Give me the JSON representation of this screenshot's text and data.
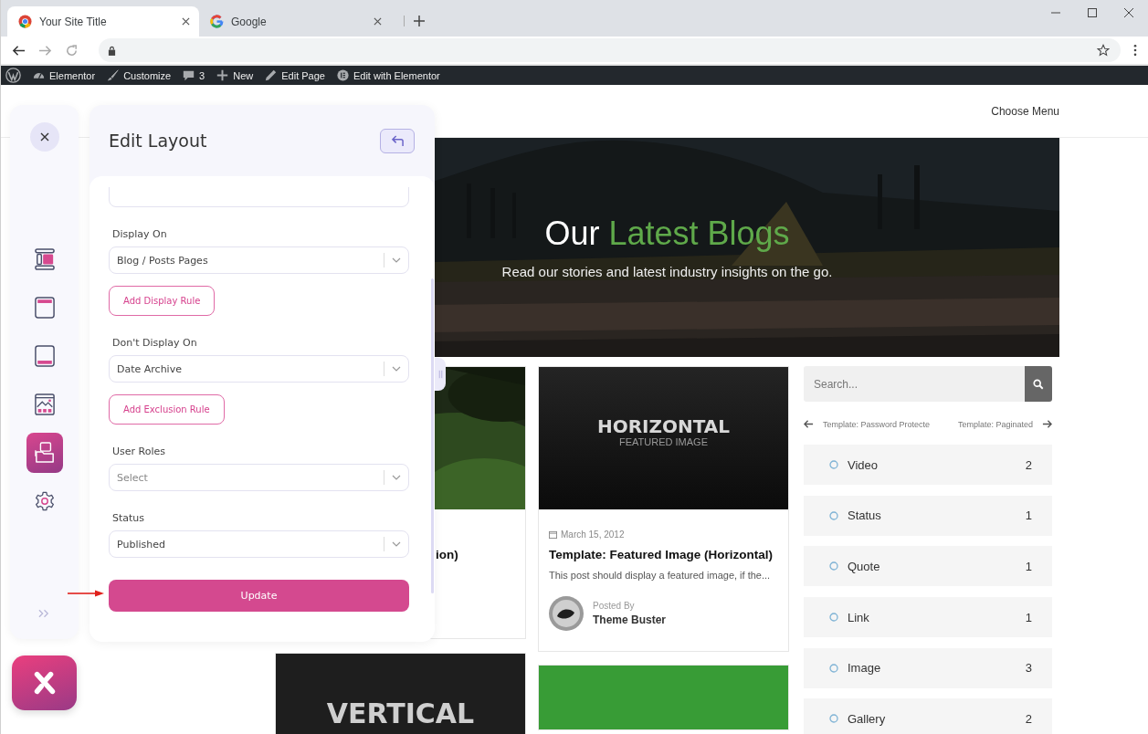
{
  "browser": {
    "tabs": [
      {
        "title": "Your Site Title",
        "selected": true
      },
      {
        "title": "Google",
        "selected": false
      }
    ]
  },
  "admin_bar": {
    "items": [
      {
        "label": "Elementor",
        "kind": "dashboard"
      },
      {
        "label": "Customize",
        "kind": "brush"
      },
      {
        "label": "3",
        "kind": "comment"
      },
      {
        "label": "New",
        "kind": "plus"
      },
      {
        "label": "Edit Page",
        "kind": "pencil"
      },
      {
        "label": "Edit with Elementor",
        "kind": "elementor"
      }
    ]
  },
  "site_header": {
    "menu": "Choose Menu"
  },
  "hero": {
    "title_start": "Our",
    "title_highlight": "Latest Blogs",
    "subtitle": "Read our stories and latest industry insights on the go."
  },
  "left_column_posts": [
    {
      "title": "ion)"
    },
    {
      "image": {
        "kind": "graphic",
        "title": "VERTICAL"
      }
    }
  ],
  "middle_column_posts": [
    {
      "image": {
        "kind": "graphic",
        "title": "HORIZONTAL",
        "subtitle": "FEATURED IMAGE"
      },
      "date": "March 15, 2012",
      "title": "Template: Featured Image (Horizontal)",
      "excerpt": "This post should display a featured image, if the...",
      "author_label": "Posted By",
      "author": "Theme Buster"
    },
    {
      "image": {
        "kind": "flat"
      }
    }
  ],
  "sidebar": {
    "search": {
      "placeholder": "Search..."
    },
    "nav": {
      "previous": "Template: Password Protecte",
      "next": "Template: Paginated"
    },
    "categories": [
      {
        "name": "Video",
        "count": "2"
      },
      {
        "name": "Status",
        "count": "1"
      },
      {
        "name": "Quote",
        "count": "1"
      },
      {
        "name": "Link",
        "count": "1"
      },
      {
        "name": "Image",
        "count": "3"
      },
      {
        "name": "Gallery",
        "count": "2"
      }
    ]
  },
  "rail": {
    "items": [
      {
        "kind": "layout",
        "selected": false
      },
      {
        "kind": "header",
        "selected": false
      },
      {
        "kind": "footer",
        "selected": false
      },
      {
        "kind": "gallery",
        "selected": false
      },
      {
        "kind": "folder",
        "selected": true
      },
      {
        "kind": "settings",
        "selected": false
      }
    ]
  },
  "panel": {
    "title": "Edit Layout",
    "fields": [
      {
        "label": "Display On",
        "value": "Blog / Posts Pages",
        "action": "Add Display Rule"
      },
      {
        "label": "Don't Display On",
        "value": "Date Archive",
        "action": "Add Exclusion Rule"
      },
      {
        "label": "User Roles",
        "placeholder": "Select"
      },
      {
        "label": "Status",
        "value": "Published"
      }
    ],
    "submit": "Update"
  }
}
